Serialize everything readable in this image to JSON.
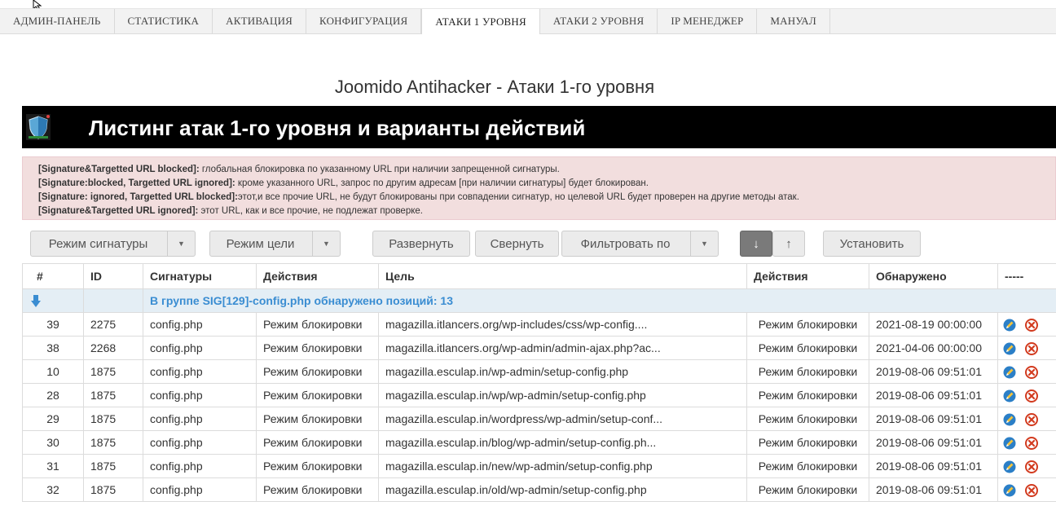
{
  "nav": {
    "tabs": [
      {
        "label": "АДМИН-ПАНЕЛЬ"
      },
      {
        "label": "СТАТИСТИКА"
      },
      {
        "label": "АКТИВАЦИЯ"
      },
      {
        "label": "КОНФИГУРАЦИЯ"
      },
      {
        "label": "АТАКИ 1 УРОВНЯ"
      },
      {
        "label": "АТАКИ 2 УРОВНЯ"
      },
      {
        "label": "IP МЕНЕДЖЕР"
      },
      {
        "label": "МАНУАЛ"
      }
    ],
    "active_index": 4
  },
  "page_title": "Joomido Antihacker - Атаки 1-го уровня",
  "banner": {
    "title": "Листинг атак 1-го уровня и варианты действий",
    "logo_icon": "shield-logo-icon"
  },
  "alert": {
    "lines": [
      {
        "key": "[Signature&Targetted URL blocked]:",
        "text": " глобальная блокировка по указанному URL при наличии запрещенной сигнатуры."
      },
      {
        "key": "[Signature:blocked, Targetted URL ignored]:",
        "text": " кроме указанного URL, запрос по другим адресам [при наличии сигнатуры] будет блокирован."
      },
      {
        "key": "[Signature: ignored, Targetted URL blocked]:",
        "text": "этот,и все прочие URL, не будут блокированы при совпадении сигнатур, но целевой URL будет проверен на другие методы атак."
      },
      {
        "key": "[Signature&Targetted URL ignored]:",
        "text": " этот URL, как и все прочие, не подлежат проверке."
      }
    ]
  },
  "toolbar": {
    "signature_mode": "Режим сигнатуры",
    "target_mode": "Режим цели",
    "expand": "Развернуть",
    "collapse": "Свернуть",
    "filter_by": "Фильтровать по",
    "sort_desc": "↓",
    "sort_asc": "↑",
    "apply": "Установить"
  },
  "table": {
    "headers": [
      "#",
      "ID",
      "Сигнатуры",
      "Действия",
      "Цель",
      "Действия",
      "Обнаружено",
      "-----"
    ],
    "group": {
      "icon": "arrow-down-icon",
      "text": "В группе SIG[129]-config.php обнаружено позиций: 13"
    },
    "rows": [
      {
        "num": "39",
        "id": "2275",
        "sig": "config.php",
        "sig_action": "Режим блокировки",
        "target": "magazilla.itlancers.org/wp-includes/css/wp-config....",
        "target_action": "Режим блокировки",
        "detected": "2021-08-19 00:00:00"
      },
      {
        "num": "38",
        "id": "2268",
        "sig": "config.php",
        "sig_action": "Режим блокировки",
        "target": "magazilla.itlancers.org/wp-admin/admin-ajax.php?ac...",
        "target_action": "Режим блокировки",
        "detected": "2021-04-06 00:00:00"
      },
      {
        "num": "10",
        "id": "1875",
        "sig": "config.php",
        "sig_action": "Режим блокировки",
        "target": "magazilla.esculap.in/wp-admin/setup-config.php",
        "target_action": "Режим блокировки",
        "detected": "2019-08-06 09:51:01"
      },
      {
        "num": "28",
        "id": "1875",
        "sig": "config.php",
        "sig_action": "Режим блокировки",
        "target": "magazilla.esculap.in/wp/wp-admin/setup-config.php",
        "target_action": "Режим блокировки",
        "detected": "2019-08-06 09:51:01"
      },
      {
        "num": "29",
        "id": "1875",
        "sig": "config.php",
        "sig_action": "Режим блокировки",
        "target": "magazilla.esculap.in/wordpress/wp-admin/setup-conf...",
        "target_action": "Режим блокировки",
        "detected": "2019-08-06 09:51:01"
      },
      {
        "num": "30",
        "id": "1875",
        "sig": "config.php",
        "sig_action": "Режим блокировки",
        "target": "magazilla.esculap.in/blog/wp-admin/setup-config.ph...",
        "target_action": "Режим блокировки",
        "detected": "2019-08-06 09:51:01"
      },
      {
        "num": "31",
        "id": "1875",
        "sig": "config.php",
        "sig_action": "Режим блокировки",
        "target": "magazilla.esculap.in/new/wp-admin/setup-config.php",
        "target_action": "Режим блокировки",
        "detected": "2019-08-06 09:51:01"
      },
      {
        "num": "32",
        "id": "1875",
        "sig": "config.php",
        "sig_action": "Режим блокировки",
        "target": "magazilla.esculap.in/old/wp-admin/setup-config.php",
        "target_action": "Режим блокировки",
        "detected": "2019-08-06 09:51:01"
      }
    ],
    "row_icons": [
      "edit-icon",
      "delete-icon"
    ]
  },
  "colors": {
    "group_text": "#3a8dd2",
    "alert_bg": "#f2dede",
    "banner_bg": "#000000"
  }
}
